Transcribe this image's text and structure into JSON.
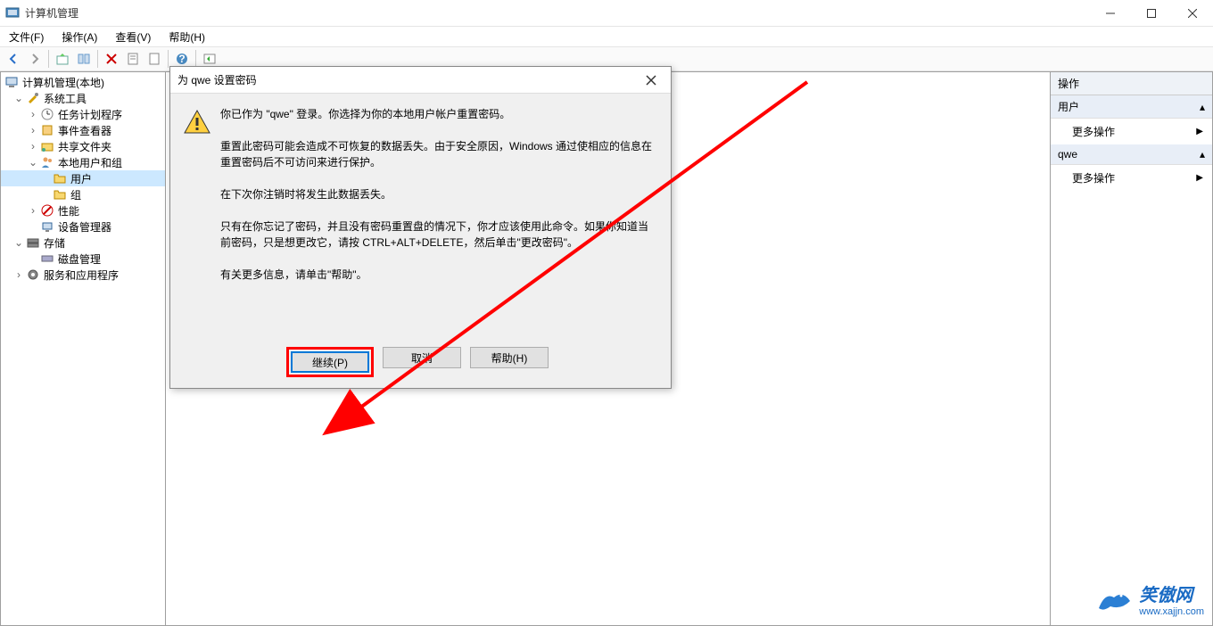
{
  "titlebar": {
    "app_name": "计算机管理"
  },
  "menubar": {
    "file": "文件(F)",
    "action": "操作(A)",
    "view": "查看(V)",
    "help": "帮助(H)"
  },
  "tree": {
    "root": "计算机管理(本地)",
    "system_tools": "系统工具",
    "task_scheduler": "任务计划程序",
    "event_viewer": "事件查看器",
    "shared_folders": "共享文件夹",
    "local_users": "本地用户和组",
    "users": "用户",
    "groups": "组",
    "performance": "性能",
    "device_manager": "设备管理器",
    "storage": "存储",
    "disk_management": "磁盘管理",
    "services_apps": "服务和应用程序"
  },
  "actions": {
    "header": "操作",
    "section1": "用户",
    "section2": "qwe",
    "more_actions": "更多操作"
  },
  "dialog": {
    "title": "为 qwe 设置密码",
    "p1": "你已作为 \"qwe\" 登录。你选择为你的本地用户帐户重置密码。",
    "p2": "重置此密码可能会造成不可恢复的数据丢失。由于安全原因，Windows 通过使相应的信息在重置密码后不可访问来进行保护。",
    "p3": "在下次你注销时将发生此数据丢失。",
    "p4": "只有在你忘记了密码，并且没有密码重置盘的情况下，你才应该使用此命令。如果你知道当前密码，只是想更改它，请按 CTRL+ALT+DELETE，然后单击\"更改密码\"。",
    "p5": "有关更多信息，请单击\"帮助\"。",
    "btn_proceed": "继续(P)",
    "btn_cancel": "取消",
    "btn_help": "帮助(H)"
  },
  "watermark": {
    "text": "笑傲网",
    "url": "www.xajjn.com"
  }
}
